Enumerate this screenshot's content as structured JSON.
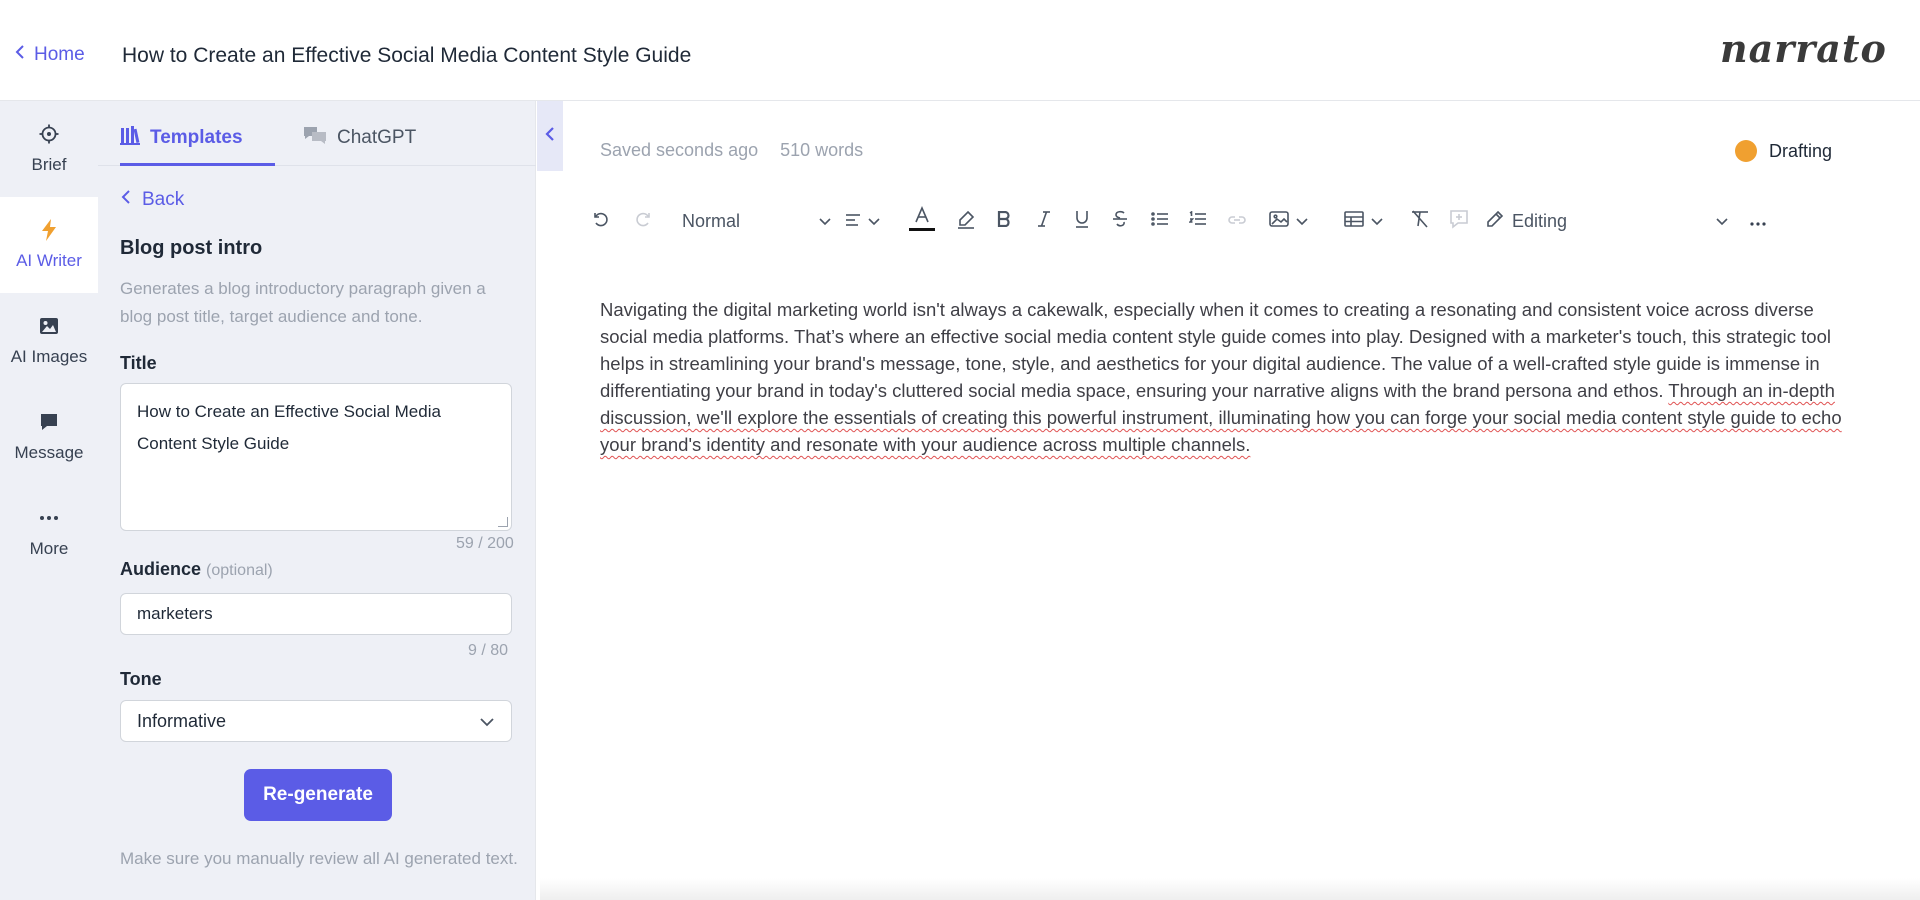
{
  "header": {
    "home_label": "Home",
    "doc_title": "How to Create an Effective Social Media Content Style Guide",
    "logo_text": "narrato"
  },
  "rail": {
    "items": [
      {
        "label": "Brief",
        "icon": "target-icon"
      },
      {
        "label": "AI Writer",
        "icon": "lightning-icon"
      },
      {
        "label": "AI Images",
        "icon": "image-icon"
      },
      {
        "label": "Message",
        "icon": "chat-icon"
      },
      {
        "label": "More",
        "icon": "ellipsis-icon"
      }
    ],
    "active": "AI Writer"
  },
  "panel": {
    "tabs": [
      {
        "label": "Templates",
        "icon": "books-icon"
      },
      {
        "label": "ChatGPT",
        "icon": "chat-bubbles-icon"
      }
    ],
    "back_label": "Back",
    "template_name": "Blog post intro",
    "template_desc": "Generates a blog introductory paragraph given a blog post title, target audience and tone.",
    "title_label": "Title",
    "title_value": "How to Create an Effective Social Media Content Style Guide",
    "title_counter": "59 / 200",
    "audience_label": "Audience",
    "audience_optional": "(optional)",
    "audience_value": "marketers",
    "audience_counter": "9 / 80",
    "tone_label": "Tone",
    "tone_value": "Informative",
    "regenerate_label": "Re-generate",
    "note": "Make sure you manually review all AI generated text."
  },
  "editor": {
    "saved_status": "Saved seconds ago",
    "word_count": "510 words",
    "status_label": "Drafting",
    "status_color": "#f0a030",
    "toolbar": {
      "paragraph_style": "Normal",
      "mode": "Editing"
    },
    "content_plain": "Navigating the digital marketing world isn't always a cakewalk, especially when it comes to creating a resonating and consistent voice across diverse social media platforms. That’s where an effective social media content style guide comes into play. Designed with a marketer's touch, this strategic tool helps in streamlining your brand's message, tone, style, and aesthetics for your digital audience. The value of a well-crafted style guide is immense in differentiating your brand in today's cluttered social media space, ensuring your narrative aligns with the brand persona and ethos.",
    "content_flagged": "Through an in-depth discussion, we'll explore the essentials of creating this powerful instrument, illuminating how you can forge your social media content style guide to echo your brand's identity and resonate with your audience across multiple channels."
  },
  "colors": {
    "accent": "#5b5ce6",
    "rail_bg": "#eef0f6"
  }
}
